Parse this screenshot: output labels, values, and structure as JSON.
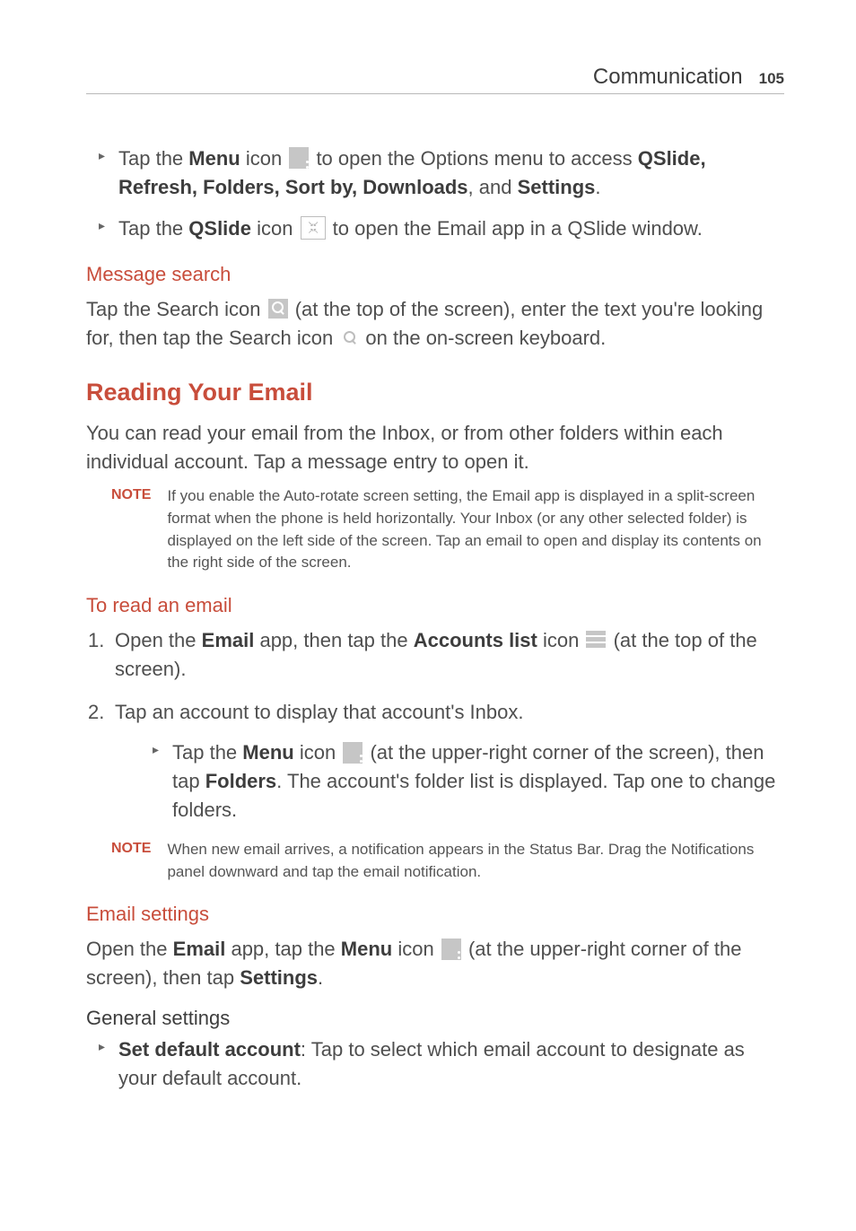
{
  "header": {
    "title": "Communication",
    "page_number": "105"
  },
  "bullets_top": [
    {
      "pre": "Tap the ",
      "bold1": "Menu",
      "mid1": " icon ",
      "icon": "menu",
      "mid2": " to open the Options menu to access ",
      "bold2": "QSlide, Refresh, Folders, Sort by, Downloads",
      "mid3": ", and ",
      "bold3": "Settings",
      "post": "."
    },
    {
      "pre": "Tap the ",
      "bold1": "QSlide",
      "mid1": " icon ",
      "icon": "qslide",
      "post": " to open the Email app in a QSlide window."
    }
  ],
  "message_search": {
    "heading": "Message search",
    "line_a": "Tap the Search icon ",
    "line_b": " (at the top of the screen), enter the text you're looking for, then tap the Search icon ",
    "line_c": " on the on-screen keyboard."
  },
  "reading": {
    "heading": "Reading Your Email",
    "para": "You can read your email from the Inbox, or from other folders within each individual account. Tap a message entry to open it.",
    "note_label": "NOTE",
    "note_text": "If you enable the Auto-rotate screen setting, the Email app is displayed in a split-screen format when the phone is held horizontally. Your Inbox (or any other selected folder) is displayed on the left side of the screen. Tap an email to open and display its contents on the right side of the screen."
  },
  "to_read": {
    "heading": "To read an email",
    "step1": {
      "pre": "Open the ",
      "bold1": "Email",
      "mid1": " app, then tap the ",
      "bold2": "Accounts list",
      "mid2": " icon ",
      "post": " (at the top of the screen)."
    },
    "step2": {
      "line": "Tap an account to display that account's Inbox.",
      "sub_pre": "Tap the ",
      "sub_bold1": "Menu",
      "sub_mid1": " icon ",
      "sub_mid2": " (at the upper-right corner of the screen), then tap ",
      "sub_bold2": "Folders",
      "sub_post": ". The account's folder list is displayed. Tap one to change folders."
    },
    "note_label": "NOTE",
    "note_text": "When new email arrives, a notification appears in the Status Bar. Drag the Notifications panel downward and tap the email notification."
  },
  "email_settings": {
    "heading": "Email settings",
    "pre": "Open the ",
    "bold1": "Email",
    "mid1": " app, tap the ",
    "bold2": "Menu",
    "mid2": " icon ",
    "mid3": " (at the upper-right corner of the screen), then tap ",
    "bold3": "Settings",
    "post": "."
  },
  "general_settings": {
    "heading": "General settings",
    "bullet_bold": "Set default account",
    "bullet_rest": ": Tap to select which email account to designate as your default account."
  }
}
